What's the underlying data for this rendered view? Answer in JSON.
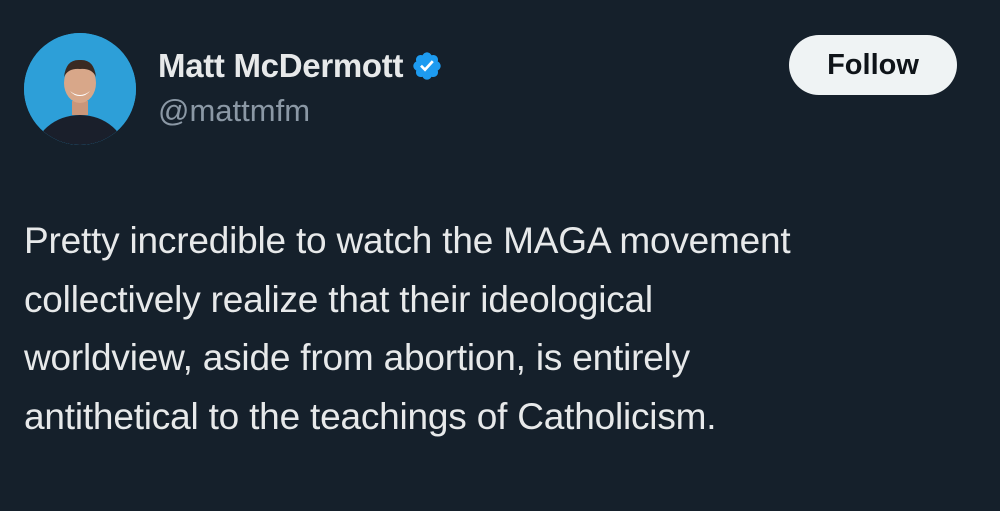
{
  "author": {
    "display_name": "Matt McDermott",
    "handle": "@mattmfm",
    "verified_icon": "verified-badge-icon",
    "avatar_bg": "#2d9fd8"
  },
  "follow_button": {
    "label": "Follow"
  },
  "tweet": {
    "lines": [
      "Pretty incredible to watch the MAGA movement",
      "collectively realize that their ideological",
      "worldview, aside from abortion, is entirely",
      "antithetical to the teachings of Catholicism."
    ]
  },
  "colors": {
    "background": "#15202b",
    "text": "#e7e9ea",
    "secondary_text": "#8b98a5",
    "verified_blue": "#1d9bf0",
    "button_bg": "#eff3f4"
  }
}
